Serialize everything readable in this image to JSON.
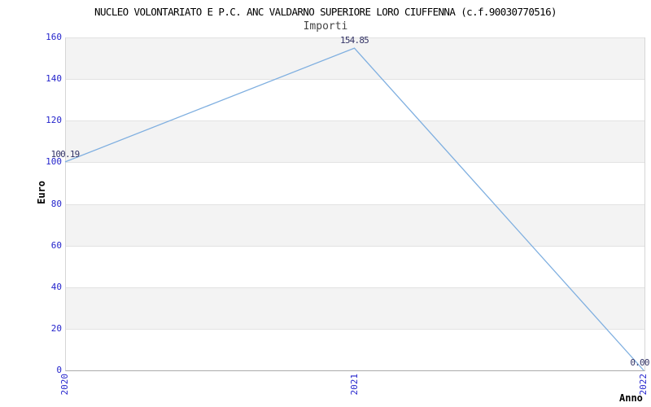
{
  "chart_data": {
    "type": "line",
    "title": "NUCLEO VOLONTARIATO E P.C. ANC VALDARNO SUPERIORE LORO CIUFFENNA (c.f.90030770516)",
    "subtitle": "Importi",
    "xlabel": "Anno",
    "ylabel": "Euro",
    "categories": [
      "2020",
      "2021",
      "2022"
    ],
    "values": [
      100.19,
      154.85,
      0.0
    ],
    "point_labels": [
      "100.19",
      "154.85",
      "0.00"
    ],
    "ylim": [
      0,
      160
    ],
    "ytick_step": 20,
    "yticks": [
      0,
      20,
      40,
      60,
      80,
      100,
      120,
      140,
      160
    ],
    "grid": "horizontal-bands-alternating",
    "legend": "none",
    "colors": {
      "line": "#7fafe0",
      "tick_label": "#2424cc",
      "point_label": "#333366",
      "band_fill": "#f3f3f3",
      "gridline": "#e2e2e2",
      "plot_border": "#d6d6d6",
      "axis_line": "#ababab",
      "title_color": "#000000",
      "subtitle_color": "#444444"
    }
  }
}
